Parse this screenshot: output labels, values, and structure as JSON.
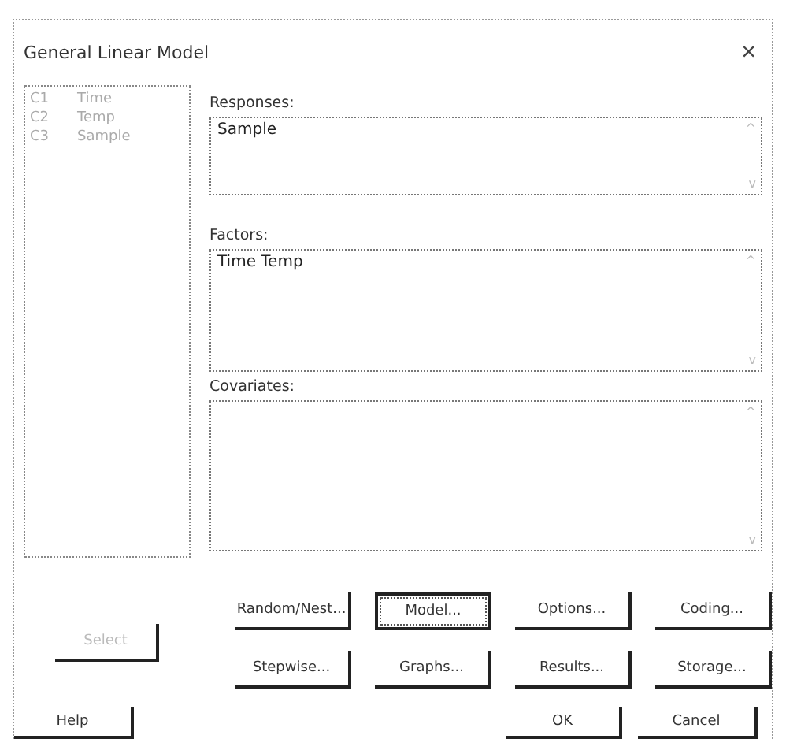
{
  "window": {
    "title": "General Linear Model",
    "close": "×"
  },
  "columns": [
    {
      "id": "C1",
      "name": "Time",
      "disabled": true
    },
    {
      "id": "C2",
      "name": "Temp",
      "disabled": true
    },
    {
      "id": "C3",
      "name": "Sample",
      "disabled": true
    }
  ],
  "fields": [
    {
      "label": "Responses:",
      "value": "Sample",
      "scroll_up": "^",
      "scroll_down": "v"
    },
    {
      "label": "Factors:",
      "value": "Time Temp",
      "scroll_up": "^",
      "scroll_down": "v"
    },
    {
      "label": "Covariates:",
      "scroll_up": "^",
      "scroll_down": "v"
    }
  ],
  "select_button": {
    "label": "Select",
    "disabled": true
  },
  "option_buttons": [
    {
      "label": "Random/Nest...",
      "default": false
    },
    {
      "label": "Model...",
      "default": true
    },
    {
      "label": "Options...",
      "default": false
    },
    {
      "label": "Coding...",
      "default": false
    },
    {
      "label": "Stepwise...",
      "default": false
    },
    {
      "label": "Graphs...",
      "default": false
    },
    {
      "label": "Results...",
      "default": false
    },
    {
      "label": "Storage...",
      "default": false
    }
  ],
  "footer_buttons": [
    {
      "label": "Help"
    },
    {
      "label": "OK"
    },
    {
      "label": "Cancel"
    }
  ]
}
